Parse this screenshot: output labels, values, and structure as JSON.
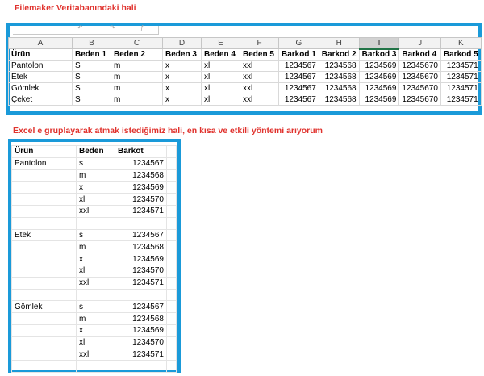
{
  "captions": {
    "top": "Filemaker Veritabanındaki hali",
    "middle": "Excel e gruplayarak atmak istediğimiz hali, en kısa ve etkili yöntemi arıyorum"
  },
  "top_grid": {
    "column_letters": [
      "A",
      "B",
      "C",
      "D",
      "E",
      "F",
      "G",
      "H",
      "I",
      "J",
      "K"
    ],
    "selected_column": "I",
    "headers": [
      "Ürün",
      "Beden 1",
      "Beden 2",
      "Beden 3",
      "Beden 4",
      "Beden 5",
      "Barkod 1",
      "Barkod 2",
      "Barkod 3",
      "Barkod 4",
      "Barkod 5"
    ],
    "rows": [
      [
        "Pantolon",
        "S",
        "m",
        "x",
        "xl",
        "xxl",
        "1234567",
        "1234568",
        "1234569",
        "12345670",
        "1234571"
      ],
      [
        "Etek",
        "S",
        "m",
        "x",
        "xl",
        "xxl",
        "1234567",
        "1234568",
        "1234569",
        "12345670",
        "1234571"
      ],
      [
        "Gömlek",
        "S",
        "m",
        "x",
        "xl",
        "xxl",
        "1234567",
        "1234568",
        "1234569",
        "12345670",
        "1234571"
      ],
      [
        "Çeket",
        "S",
        "m",
        "x",
        "xl",
        "xxl",
        "1234567",
        "1234568",
        "1234569",
        "12345670",
        "1234571"
      ]
    ]
  },
  "bottom_grid": {
    "headers": [
      "Ürün",
      "Beden",
      "Barkot"
    ],
    "rows": [
      [
        "Pantolon",
        "s",
        "1234567"
      ],
      [
        "",
        "m",
        "1234568"
      ],
      [
        "",
        "x",
        "1234569"
      ],
      [
        "",
        "xl",
        "1234570"
      ],
      [
        "",
        "xxl",
        "1234571"
      ],
      [
        "",
        "",
        ""
      ],
      [
        "Etek",
        "s",
        "1234567"
      ],
      [
        "",
        "m",
        "1234568"
      ],
      [
        "",
        "x",
        "1234569"
      ],
      [
        "",
        "xl",
        "1234570"
      ],
      [
        "",
        "xxl",
        "1234571"
      ],
      [
        "",
        "",
        ""
      ],
      [
        "Gömlek",
        "s",
        "1234567"
      ],
      [
        "",
        "m",
        "1234568"
      ],
      [
        "",
        "x",
        "1234569"
      ],
      [
        "",
        "xl",
        "1234570"
      ],
      [
        "",
        "xxl",
        "1234571"
      ],
      [
        "",
        "",
        ""
      ]
    ]
  }
}
